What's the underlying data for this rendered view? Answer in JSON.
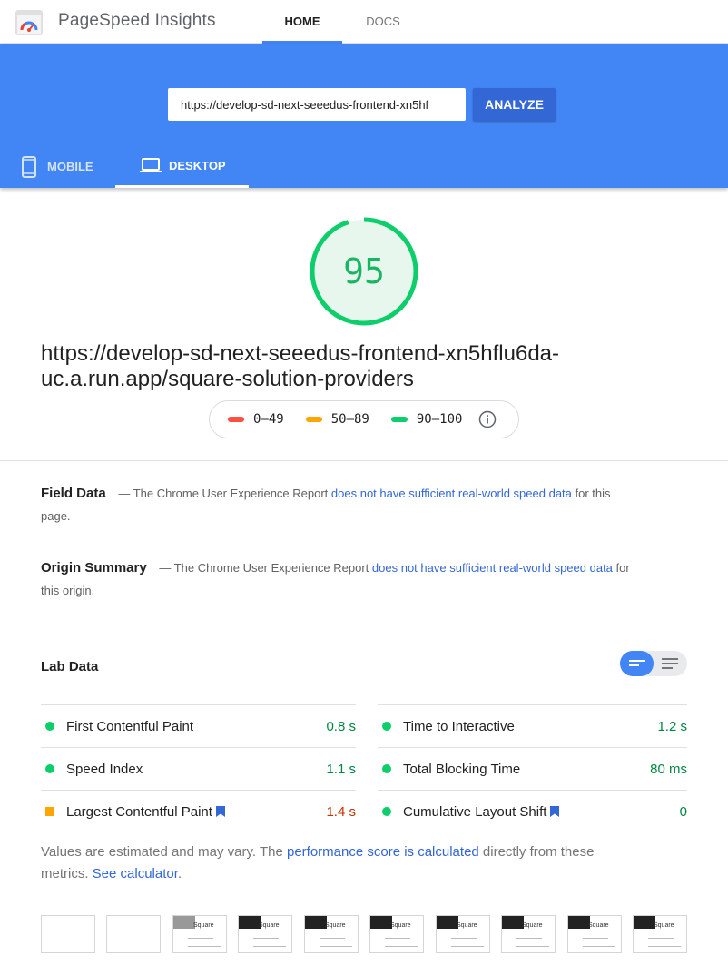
{
  "app": {
    "title": "PageSpeed Insights"
  },
  "nav": {
    "tabs": [
      {
        "label": "HOME"
      },
      {
        "label": "DOCS"
      }
    ]
  },
  "search": {
    "url_value": "https://develop-sd-next-seeedus-frontend-xn5hf",
    "analyze_label": "ANALYZE"
  },
  "devices": {
    "mobile_label": "MOBILE",
    "desktop_label": "DESKTOP"
  },
  "score": {
    "value": "95",
    "fraction": 0.95,
    "color": "#0cce6b"
  },
  "page_url": "https://develop-sd-next-seeedus-frontend-xn5hflu6da-uc.a.run.app/square-solution-providers",
  "legend": [
    {
      "label": "0–49",
      "color": "#ff4e42"
    },
    {
      "label": "50–89",
      "color": "#ffa400"
    },
    {
      "label": "90–100",
      "color": "#0cce6b"
    }
  ],
  "field_data": {
    "title": "Field Data",
    "prefix": "— The Chrome User Experience Report",
    "link": "does not have sufficient real-world speed data",
    "suffix": "for this page."
  },
  "origin_summary": {
    "title": "Origin Summary",
    "prefix": "— The Chrome User Experience Report",
    "link": "does not have sufficient real-world speed data",
    "suffix": "for this origin."
  },
  "lab_data": {
    "title": "Lab Data",
    "metrics": [
      {
        "label": "First Contentful Paint",
        "value": "0.8 s",
        "status": "pass",
        "color": "#0cce6b",
        "value_color": "#018642"
      },
      {
        "label": "Time to Interactive",
        "value": "1.2 s",
        "status": "pass",
        "color": "#0cce6b",
        "value_color": "#018642"
      },
      {
        "label": "Speed Index",
        "value": "1.1 s",
        "status": "pass",
        "color": "#0cce6b",
        "value_color": "#018642"
      },
      {
        "label": "Total Blocking Time",
        "value": "80 ms",
        "status": "pass",
        "color": "#0cce6b",
        "value_color": "#018642"
      },
      {
        "label": "Largest Contentful Paint",
        "value": "1.4 s",
        "status": "average",
        "color": "#ffa400",
        "value_color": "#c33300"
      },
      {
        "label": "Cumulative Layout Shift",
        "value": "0",
        "status": "pass",
        "color": "#0cce6b",
        "value_color": "#018642"
      }
    ],
    "note_prefix": "Values are estimated and may vary. The",
    "note_link": "performance score is calculated",
    "note_middle": "directly from these metrics.",
    "note_link2": "See calculator",
    "note_end": "."
  },
  "filmstrip": {
    "frame_brand": "Square"
  }
}
